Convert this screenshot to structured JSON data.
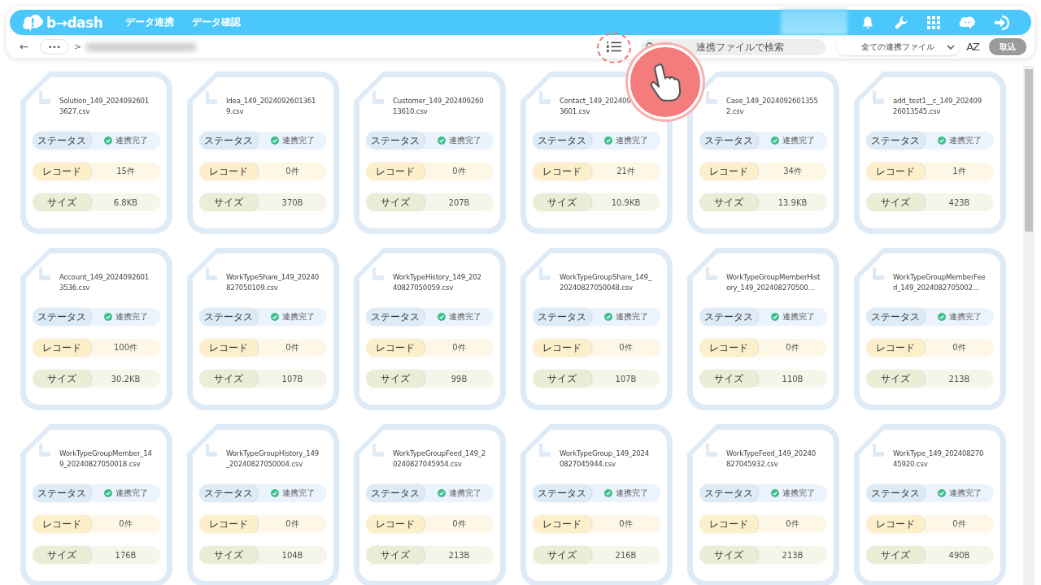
{
  "header": {
    "logo": "b→dash",
    "nav": [
      {
        "label": "データ連携"
      },
      {
        "label": "データ確認"
      }
    ]
  },
  "toolbar": {
    "back": "←",
    "more": "•••",
    "separator": ">",
    "search": {
      "placeholder": "連携ファイルで検索"
    },
    "filter": {
      "value": "全ての連携ファイル"
    },
    "sort": "AZ",
    "import_button": {
      "label": "取込",
      "disabled": true
    },
    "list_view_highlighted": true
  },
  "cards": [
    {
      "name_lines": [
        "Solution_149_2024092601",
        "3627.csv"
      ],
      "fields": [
        {
          "kind": "status",
          "label": "ステータス",
          "value": "連携完了",
          "complete": true
        },
        {
          "kind": "records",
          "label": "レコード",
          "value": "15件"
        },
        {
          "kind": "size",
          "label": "サイズ",
          "value": "6.8KB"
        }
      ]
    },
    {
      "name_lines": [
        "Idea_149_2024092601361",
        "9.csv"
      ],
      "fields": [
        {
          "kind": "status",
          "label": "ステータス",
          "value": "連携完了",
          "complete": true
        },
        {
          "kind": "records",
          "label": "レコード",
          "value": "0件"
        },
        {
          "kind": "size",
          "label": "サイズ",
          "value": "370B"
        }
      ]
    },
    {
      "name_lines": [
        "Customer_149_202409260",
        "13610.csv"
      ],
      "fields": [
        {
          "kind": "status",
          "label": "ステータス",
          "value": "連携完了",
          "complete": true
        },
        {
          "kind": "records",
          "label": "レコード",
          "value": "0件"
        },
        {
          "kind": "size",
          "label": "サイズ",
          "value": "207B"
        }
      ]
    },
    {
      "name_lines": [
        "Contact_149_202409",
        "3601.csv"
      ],
      "fields": [
        {
          "kind": "status",
          "label": "ステータス",
          "value": "連携完了",
          "complete": true
        },
        {
          "kind": "records",
          "label": "レコード",
          "value": "21件"
        },
        {
          "kind": "size",
          "label": "サイズ",
          "value": "10.9KB"
        }
      ]
    },
    {
      "name_lines": [
        "Case_149_2024092601355",
        "2.csv"
      ],
      "fields": [
        {
          "kind": "status",
          "label": "ステータス",
          "value": "連携完了",
          "complete": true
        },
        {
          "kind": "records",
          "label": "レコード",
          "value": "34件"
        },
        {
          "kind": "size",
          "label": "サイズ",
          "value": "13.9KB"
        }
      ]
    },
    {
      "name_lines": [
        "add_test1__c_149_202409",
        "26013545.csv"
      ],
      "fields": [
        {
          "kind": "status",
          "label": "ステータス",
          "value": "連携完了",
          "complete": true
        },
        {
          "kind": "records",
          "label": "レコード",
          "value": "1件"
        },
        {
          "kind": "size",
          "label": "サイズ",
          "value": "423B"
        }
      ]
    },
    {
      "name_lines": [
        "Account_149_2024092601",
        "3536.csv"
      ],
      "fields": [
        {
          "kind": "status",
          "label": "ステータス",
          "value": "連携完了",
          "complete": true
        },
        {
          "kind": "records",
          "label": "レコード",
          "value": "100件"
        },
        {
          "kind": "size",
          "label": "サイズ",
          "value": "30.2KB"
        }
      ]
    },
    {
      "name_lines": [
        "WorkTypeShare_149_20240",
        "827050109.csv"
      ],
      "fields": [
        {
          "kind": "status",
          "label": "ステータス",
          "value": "連携完了",
          "complete": true
        },
        {
          "kind": "records",
          "label": "レコード",
          "value": "0件"
        },
        {
          "kind": "size",
          "label": "サイズ",
          "value": "107B"
        }
      ]
    },
    {
      "name_lines": [
        "WorkTypeHistory_149_202",
        "40827050059.csv"
      ],
      "fields": [
        {
          "kind": "status",
          "label": "ステータス",
          "value": "連携完了",
          "complete": true
        },
        {
          "kind": "records",
          "label": "レコード",
          "value": "0件"
        },
        {
          "kind": "size",
          "label": "サイズ",
          "value": "99B"
        }
      ]
    },
    {
      "name_lines": [
        "WorkTypeGroupShare_149_",
        "20240827050048.csv"
      ],
      "fields": [
        {
          "kind": "status",
          "label": "ステータス",
          "value": "連携完了",
          "complete": true
        },
        {
          "kind": "records",
          "label": "レコード",
          "value": "0件"
        },
        {
          "kind": "size",
          "label": "サイズ",
          "value": "107B"
        }
      ]
    },
    {
      "name_lines": [
        "WorkTypeGroupMemberHist",
        "ory_149_202408270500…"
      ],
      "fields": [
        {
          "kind": "status",
          "label": "ステータス",
          "value": "連携完了",
          "complete": true
        },
        {
          "kind": "records",
          "label": "レコード",
          "value": "0件"
        },
        {
          "kind": "size",
          "label": "サイズ",
          "value": "110B"
        }
      ]
    },
    {
      "name_lines": [
        "WorkTypeGroupMemberFee",
        "d_149_2024082705002…"
      ],
      "fields": [
        {
          "kind": "status",
          "label": "ステータス",
          "value": "連携完了",
          "complete": true
        },
        {
          "kind": "records",
          "label": "レコード",
          "value": "0件"
        },
        {
          "kind": "size",
          "label": "サイズ",
          "value": "213B"
        }
      ]
    },
    {
      "name_lines": [
        "WorkTypeGroupMember_14",
        "9_20240827050018.csv"
      ],
      "fields": [
        {
          "kind": "status",
          "label": "ステータス",
          "value": "連携完了",
          "complete": true
        },
        {
          "kind": "records",
          "label": "レコード",
          "value": "0件"
        },
        {
          "kind": "size",
          "label": "サイズ",
          "value": "176B"
        }
      ]
    },
    {
      "name_lines": [
        "WorkTypeGroupHistory_149",
        "_20240827050004.csv"
      ],
      "fields": [
        {
          "kind": "status",
          "label": "ステータス",
          "value": "連携完了",
          "complete": true
        },
        {
          "kind": "records",
          "label": "レコード",
          "value": "0件"
        },
        {
          "kind": "size",
          "label": "サイズ",
          "value": "104B"
        }
      ]
    },
    {
      "name_lines": [
        "WorkTypeGroupFeed_149_2",
        "0240827045954.csv"
      ],
      "fields": [
        {
          "kind": "status",
          "label": "ステータス",
          "value": "連携完了",
          "complete": true
        },
        {
          "kind": "records",
          "label": "レコード",
          "value": "0件"
        },
        {
          "kind": "size",
          "label": "サイズ",
          "value": "213B"
        }
      ]
    },
    {
      "name_lines": [
        "WorkTypeGroup_149_2024",
        "0827045944.csv"
      ],
      "fields": [
        {
          "kind": "status",
          "label": "ステータス",
          "value": "連携完了",
          "complete": true
        },
        {
          "kind": "records",
          "label": "レコード",
          "value": "0件"
        },
        {
          "kind": "size",
          "label": "サイズ",
          "value": "216B"
        }
      ]
    },
    {
      "name_lines": [
        "WorkTypeFeed_149_20240",
        "827045932.csv"
      ],
      "fields": [
        {
          "kind": "status",
          "label": "ステータス",
          "value": "連携完了",
          "complete": true
        },
        {
          "kind": "records",
          "label": "レコード",
          "value": "0件"
        },
        {
          "kind": "size",
          "label": "サイズ",
          "value": "213B"
        }
      ]
    },
    {
      "name_lines": [
        "WorkType_149_202408270",
        "45920.csv"
      ],
      "fields": [
        {
          "kind": "status",
          "label": "ステータス",
          "value": "連携完了",
          "complete": true
        },
        {
          "kind": "records",
          "label": "レコード",
          "value": "0件"
        },
        {
          "kind": "size",
          "label": "サイズ",
          "value": "490B"
        }
      ]
    }
  ]
}
